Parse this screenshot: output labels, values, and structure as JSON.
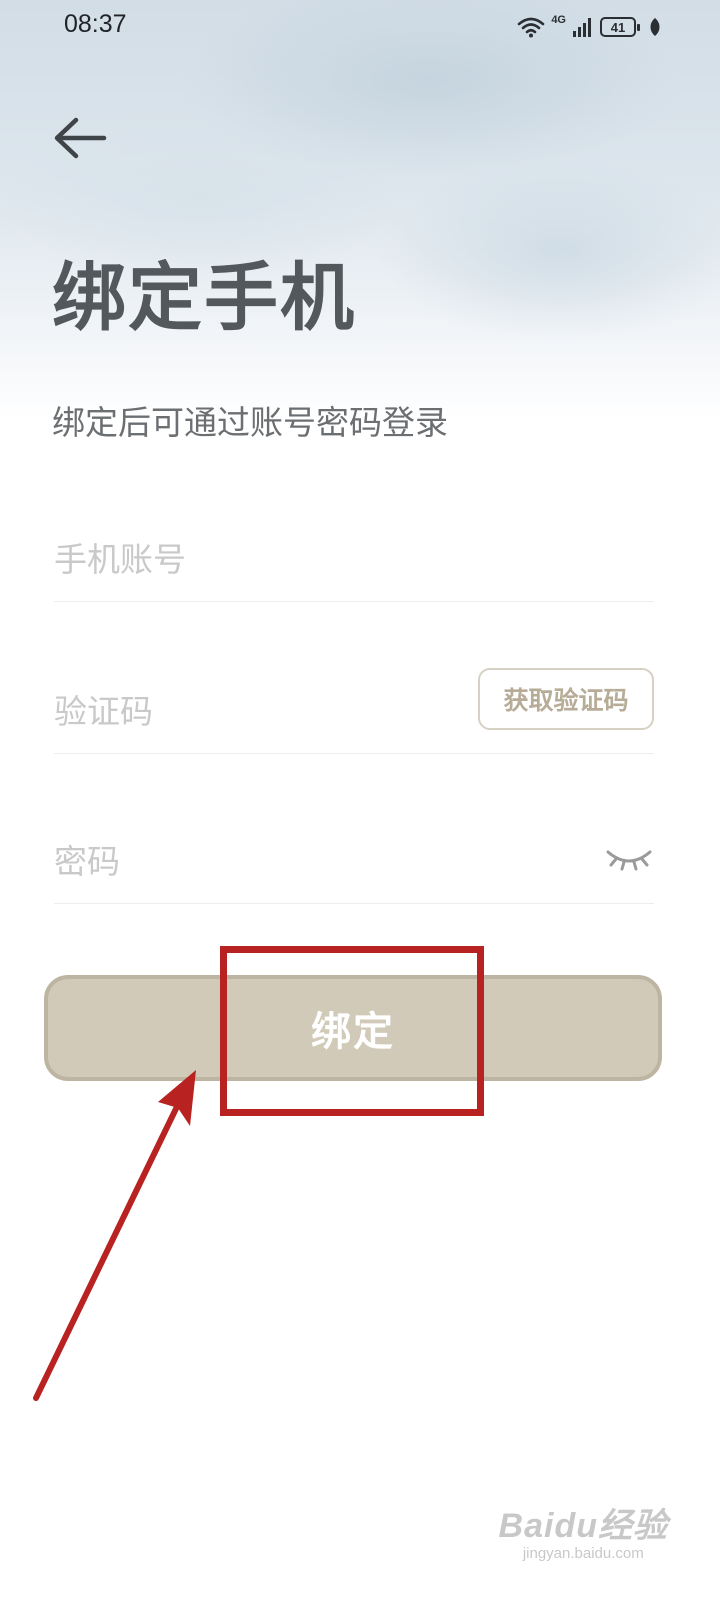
{
  "status_bar": {
    "time": "08:37",
    "network": "4G",
    "battery": "41"
  },
  "header": {
    "title": "绑定手机",
    "subtitle": "绑定后可通过账号密码登录"
  },
  "form": {
    "phone_placeholder": "手机账号",
    "code_placeholder": "验证码",
    "get_code_label": "获取验证码",
    "password_placeholder": "密码"
  },
  "actions": {
    "bind_label": "绑定"
  },
  "watermark": {
    "logo": "Baidu经验",
    "url": "jingyan.baidu.com"
  },
  "colors": {
    "primary_button": "#d1cab9",
    "annotation_red": "#b82220",
    "title": "#53585c"
  },
  "icons": [
    "arrow-left-icon",
    "wifi-icon",
    "signal-icon",
    "battery-icon",
    "leaf-icon",
    "eye-closed-icon"
  ]
}
